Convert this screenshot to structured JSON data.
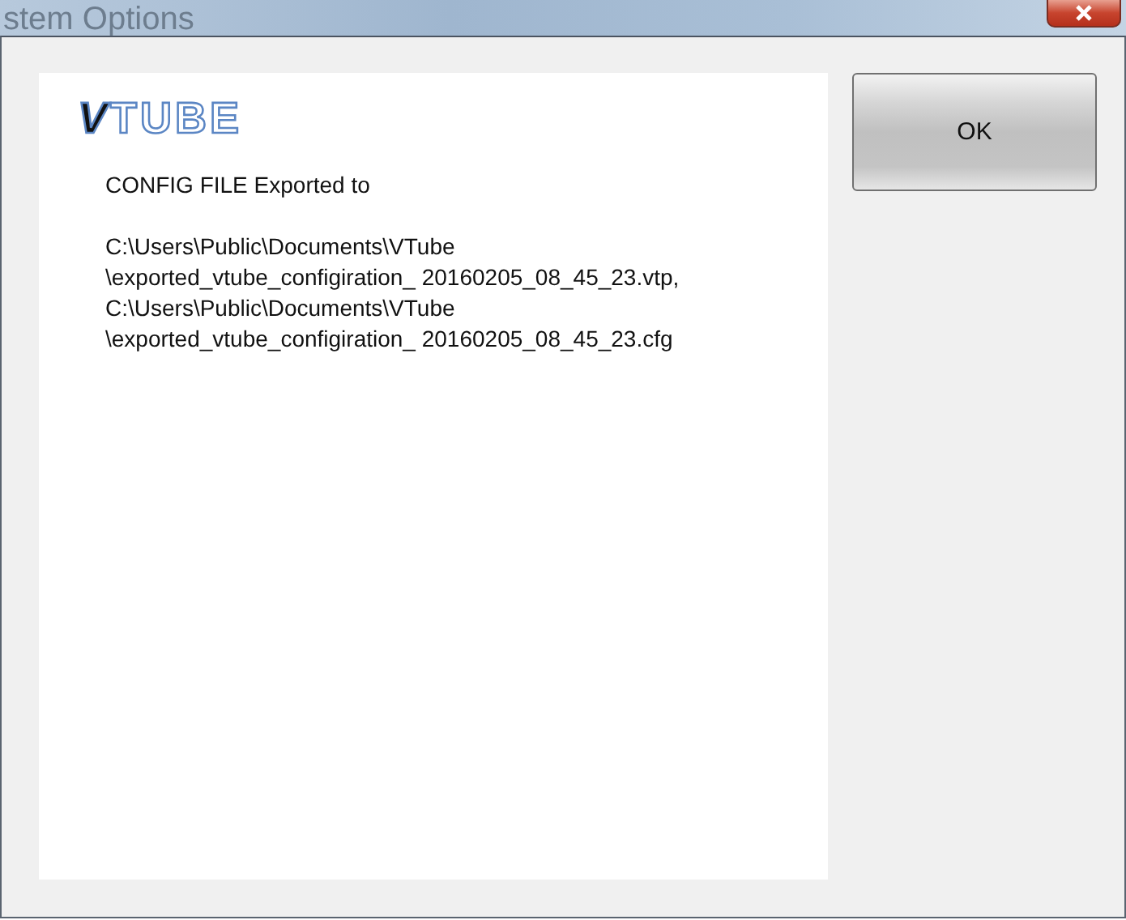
{
  "background_window": {
    "title": "stem Options"
  },
  "dialog": {
    "logo": "VTUBE",
    "heading": "CONFIG FILE Exported to",
    "lines": [
      "C:\\Users\\Public\\Documents\\VTube",
      "\\exported_vtube_configiration_ 20160205_08_45_23.vtp,",
      "C:\\Users\\Public\\Documents\\VTube",
      "\\exported_vtube_configiration_ 20160205_08_45_23.cfg"
    ],
    "buttons": [
      "OK"
    ]
  }
}
